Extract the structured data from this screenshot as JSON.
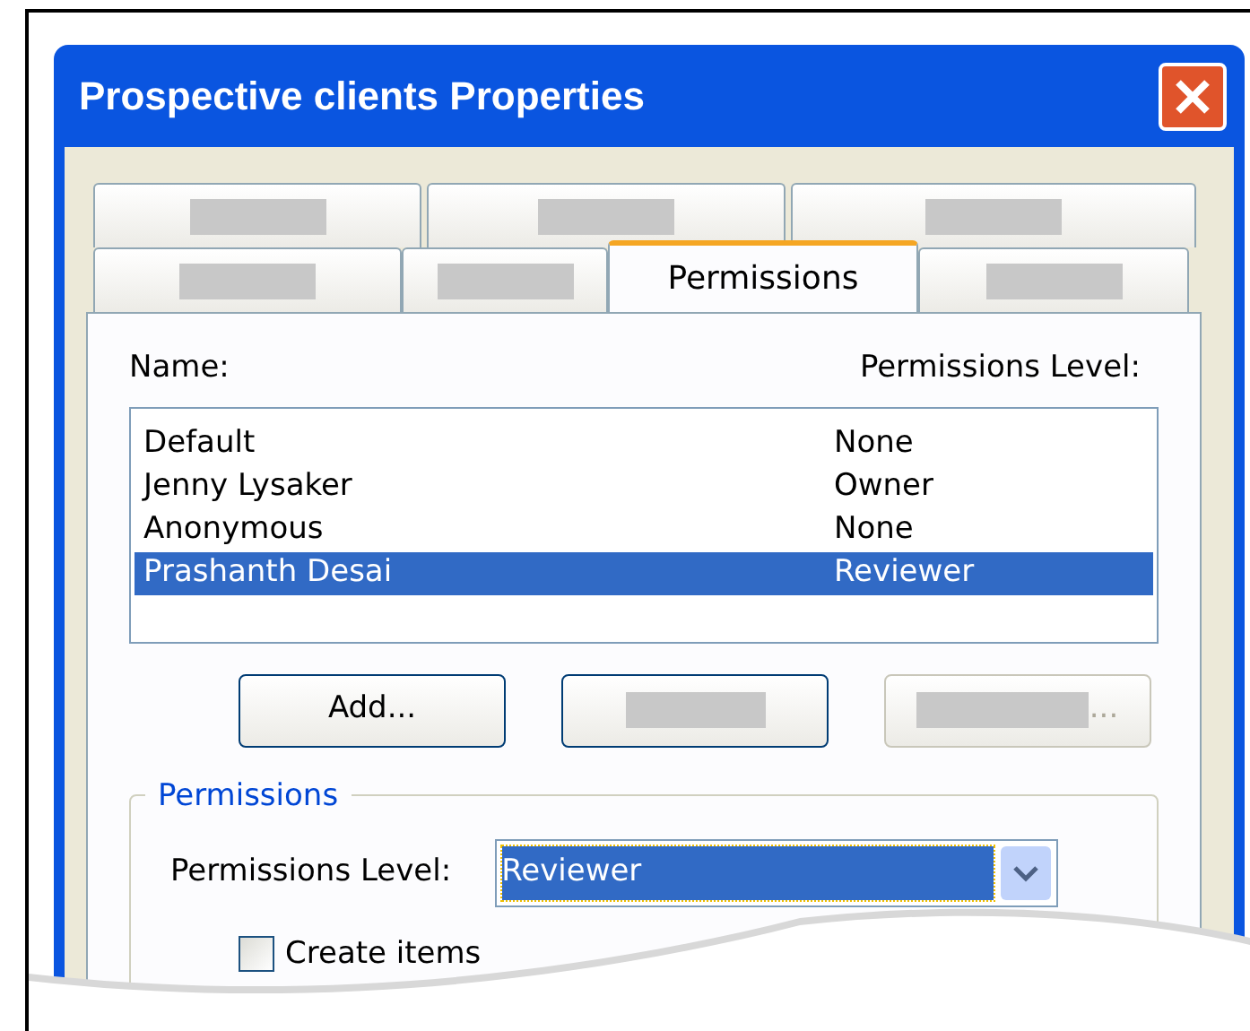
{
  "window": {
    "title": "Prospective clients Properties"
  },
  "tab_rows": [
    [
      {
        "selected": false
      },
      {
        "selected": false
      },
      {
        "selected": false
      }
    ],
    [
      {
        "selected": false
      },
      {
        "selected": false
      },
      {
        "label": "Permissions",
        "selected": true
      },
      {
        "selected": false
      }
    ]
  ],
  "list": {
    "columns": [
      "Name:",
      "Permissions Level:"
    ],
    "rows": [
      {
        "name": "Default",
        "level": "None",
        "selected": false
      },
      {
        "name": "Jenny Lysaker",
        "level": "Owner",
        "selected": false
      },
      {
        "name": "Anonymous",
        "level": "None",
        "selected": false
      },
      {
        "name": "Prashanth Desai",
        "level": "Reviewer",
        "selected": true
      }
    ]
  },
  "buttons": [
    {
      "label": "Add...",
      "disabled": false
    },
    {
      "disabled": false
    },
    {
      "suffix": "...",
      "disabled": true
    }
  ],
  "group": {
    "legend": "Permissions",
    "level_label": "Permissions Level:",
    "level_value": "Reviewer",
    "checkboxes": [
      {
        "label": "Create items",
        "checked": false
      }
    ]
  }
}
